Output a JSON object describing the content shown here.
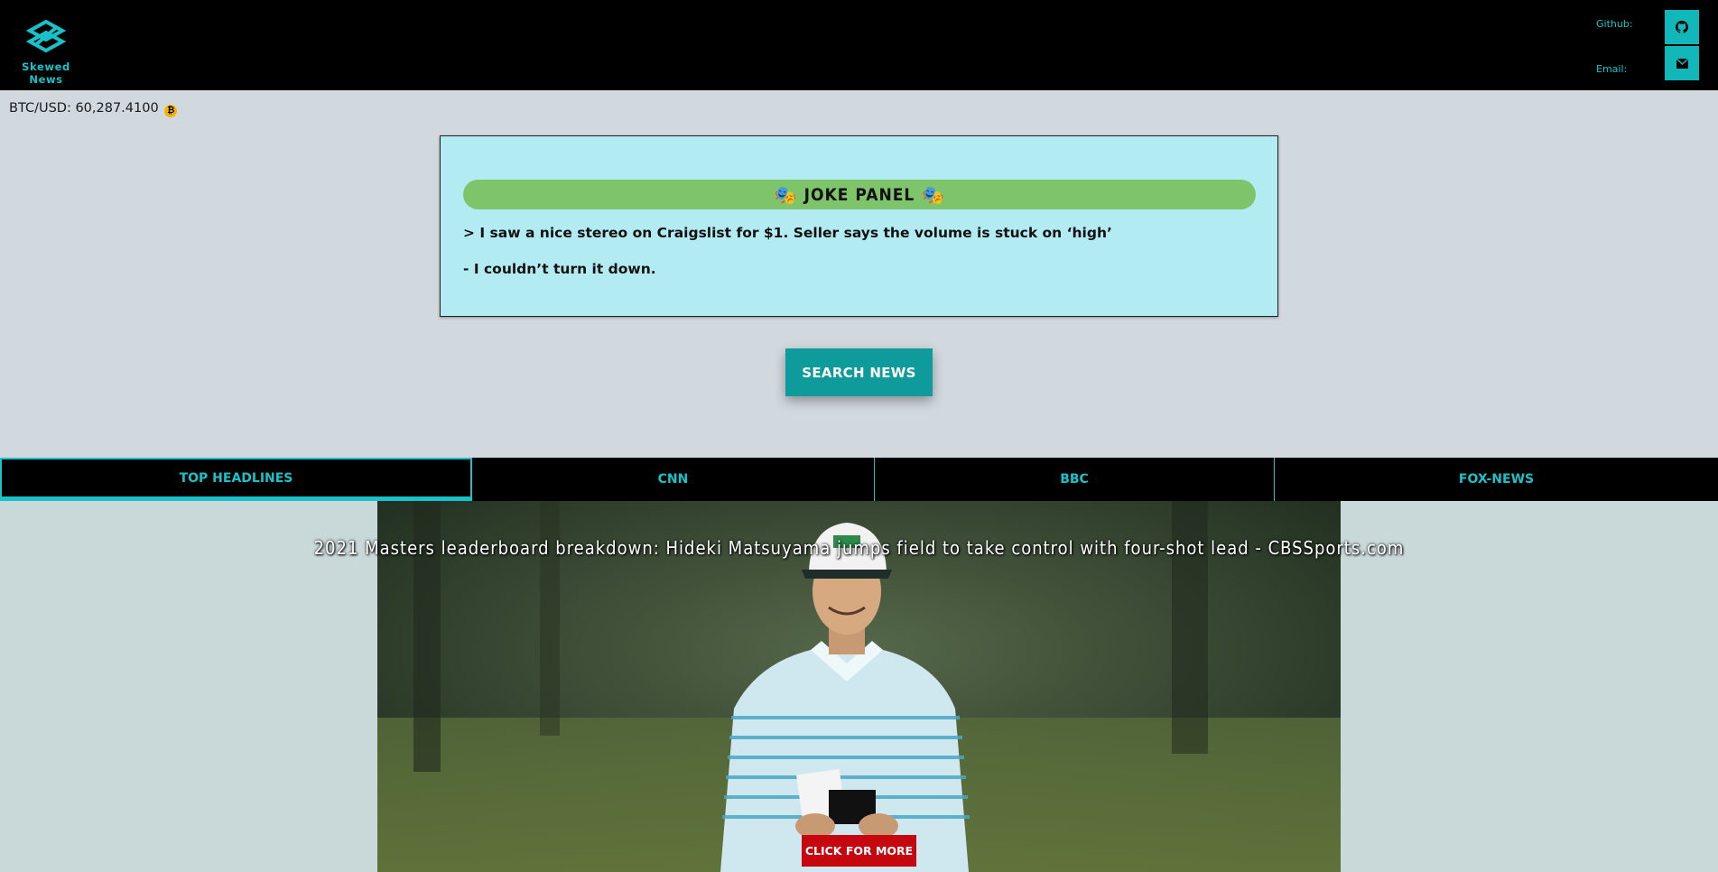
{
  "header": {
    "logo_text": "Skewed News",
    "github_label": "Github:",
    "email_label": "Email:",
    "github_icon": "github-icon",
    "email_icon": "envelope-icon"
  },
  "btc": {
    "label": "BTC/USD: 60,287.4100",
    "symbol": "₿"
  },
  "joke_panel": {
    "title": "JOKE PANEL",
    "mask_emoji": "🎭",
    "setup": "> I saw a nice stereo on Craigslist for $1. Seller says the volume is stuck on ‘high’",
    "punchline": "- I couldn’t turn it down."
  },
  "search_button": "SEARCH NEWS",
  "tabs": [
    {
      "label": "TOP HEADLINES",
      "active": true
    },
    {
      "label": "CNN",
      "active": false
    },
    {
      "label": "BBC",
      "active": false
    },
    {
      "label": "FOX-NEWS",
      "active": false
    }
  ],
  "article": {
    "headline": "2021 Masters leaderboard breakdown: Hideki Matsuyama jumps field to take control with four-shot lead - CBSSports.com",
    "button": "CLICK FOR MORE"
  },
  "colors": {
    "accent": "#19c2c9",
    "joke_bg": "#b2ecf2",
    "joke_header": "#7dc46a",
    "search_btn": "#0f9a9b",
    "more_btn": "#c7070f"
  }
}
